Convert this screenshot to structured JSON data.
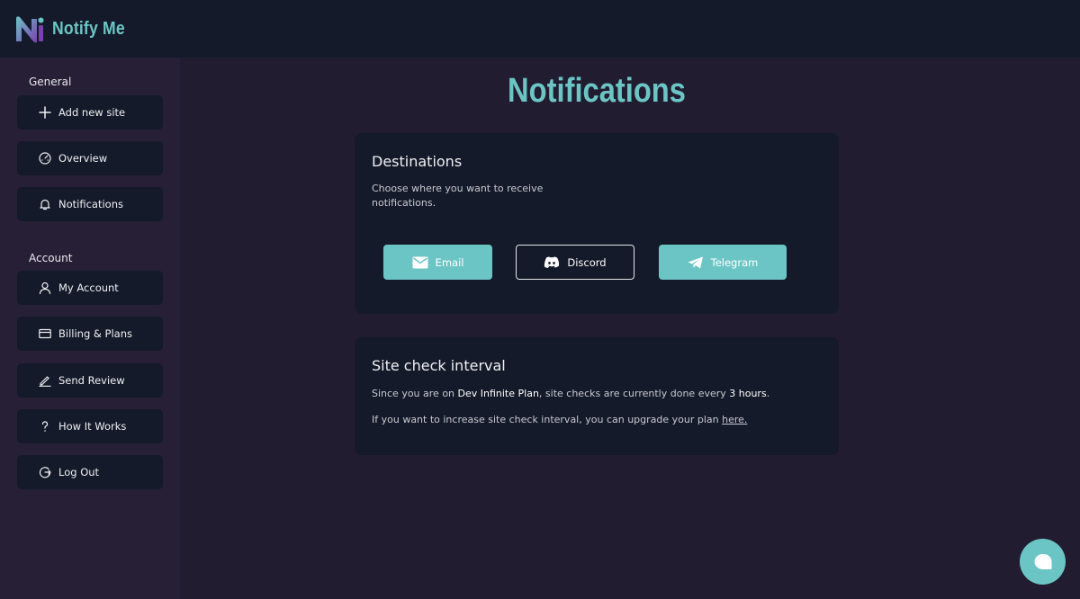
{
  "app": {
    "name": "Notify Me"
  },
  "sidebar": {
    "general_label": "General",
    "general_items": [
      {
        "label": "Add new site",
        "icon": "plus-icon"
      },
      {
        "label": "Overview",
        "icon": "gauge-icon"
      },
      {
        "label": "Notifications",
        "icon": "bell-icon"
      }
    ],
    "account_label": "Account",
    "account_items": [
      {
        "label": "My Account",
        "icon": "user-icon"
      },
      {
        "label": "Billing & Plans",
        "icon": "credit-card-icon"
      },
      {
        "label": "Send Review",
        "icon": "pen-icon"
      },
      {
        "label": "How It Works",
        "icon": "question-icon"
      },
      {
        "label": "Log Out",
        "icon": "logout-icon"
      }
    ]
  },
  "main": {
    "title": "Notifications",
    "destinations": {
      "title": "Destinations",
      "subtitle": "Choose where you want to receive notifications.",
      "buttons": [
        {
          "label": "Email",
          "icon": "mail-icon",
          "style": "filled"
        },
        {
          "label": "Discord",
          "icon": "discord-icon",
          "style": "outline"
        },
        {
          "label": "Telegram",
          "icon": "telegram-icon",
          "style": "filled"
        }
      ]
    },
    "interval": {
      "title": "Site check interval",
      "line1_prefix": "Since you are on ",
      "plan_name": "Dev Infinite Plan",
      "line1_middle": ", site checks are currently done every ",
      "interval_value": "3 hours",
      "line1_suffix": ".",
      "line2_prefix": "If you want to increase site check interval, you can upgrade your plan ",
      "line2_link": "here."
    }
  },
  "chat": {
    "icon": "chat-bubble-icon"
  },
  "colors": {
    "accent": "#6cc5c5",
    "topbar_bg": "#141a29",
    "sidebar_bg": "#261f35",
    "page_bg": "#221c30",
    "card_bg": "#141a29"
  }
}
